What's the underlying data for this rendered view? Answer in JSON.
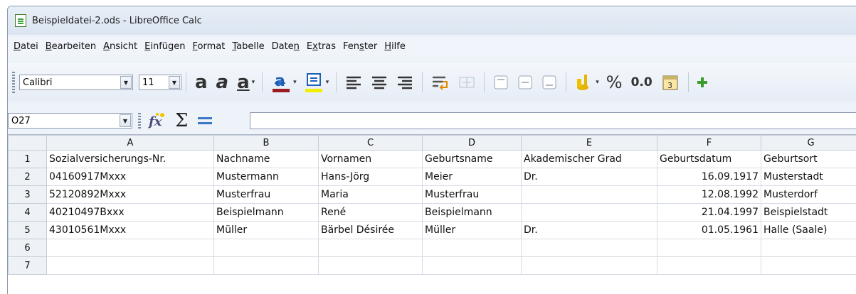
{
  "window": {
    "title": "Beispieldatei-2.ods - LibreOffice Calc"
  },
  "menu": [
    {
      "pre": "",
      "u": "D",
      "post": "atei"
    },
    {
      "pre": "",
      "u": "B",
      "post": "earbeiten"
    },
    {
      "pre": "",
      "u": "A",
      "post": "nsicht"
    },
    {
      "pre": "",
      "u": "E",
      "post": "infügen"
    },
    {
      "pre": "",
      "u": "F",
      "post": "ormat"
    },
    {
      "pre": "",
      "u": "T",
      "post": "abelle"
    },
    {
      "pre": "Date",
      "u": "n",
      "post": ""
    },
    {
      "pre": "E",
      "u": "x",
      "post": "tras"
    },
    {
      "pre": "Fen",
      "u": "s",
      "post": "ter"
    },
    {
      "pre": "",
      "u": "H",
      "post": "ilfe"
    }
  ],
  "toolbar": {
    "font_name": "Calibri",
    "font_size": "11",
    "percent": "%",
    "decimal": "0.0"
  },
  "formula": {
    "cell_ref": "O27",
    "value": ""
  },
  "sheet": {
    "columns": [
      "A",
      "B",
      "C",
      "D",
      "E",
      "F",
      "G"
    ],
    "rows": [
      {
        "n": "1",
        "cells": [
          "Sozialversicherungs-Nr.",
          "Nachname",
          "Vornamen",
          "Geburtsname",
          "Akademischer Grad",
          "Geburtsdatum",
          "Geburtsort"
        ]
      },
      {
        "n": "2",
        "cells": [
          "04160917Mxxx",
          "Mustermann",
          "Hans-Jörg",
          "Meier",
          "Dr.",
          "16.09.1917",
          "Musterstadt"
        ]
      },
      {
        "n": "3",
        "cells": [
          "52120892Mxxx",
          "Musterfrau",
          "Maria",
          "Musterfrau",
          "",
          "12.08.1992",
          "Musterdorf"
        ]
      },
      {
        "n": "4",
        "cells": [
          "40210497Bxxx",
          "Beispielmann",
          "René",
          "Beispielmann",
          "",
          "21.04.1997",
          "Beispielstadt"
        ]
      },
      {
        "n": "5",
        "cells": [
          "43010561Mxxx",
          "Müller",
          "Bärbel Désirée",
          "Müller",
          "Dr.",
          "01.05.1961",
          "Halle (Saale)"
        ]
      },
      {
        "n": "6",
        "cells": [
          "",
          "",
          "",
          "",
          "",
          "",
          ""
        ]
      },
      {
        "n": "7",
        "cells": [
          "",
          "",
          "",
          "",
          "",
          "",
          ""
        ]
      }
    ]
  },
  "colors": {
    "font_color": "#c0282b",
    "highlight": "#ffff00"
  }
}
